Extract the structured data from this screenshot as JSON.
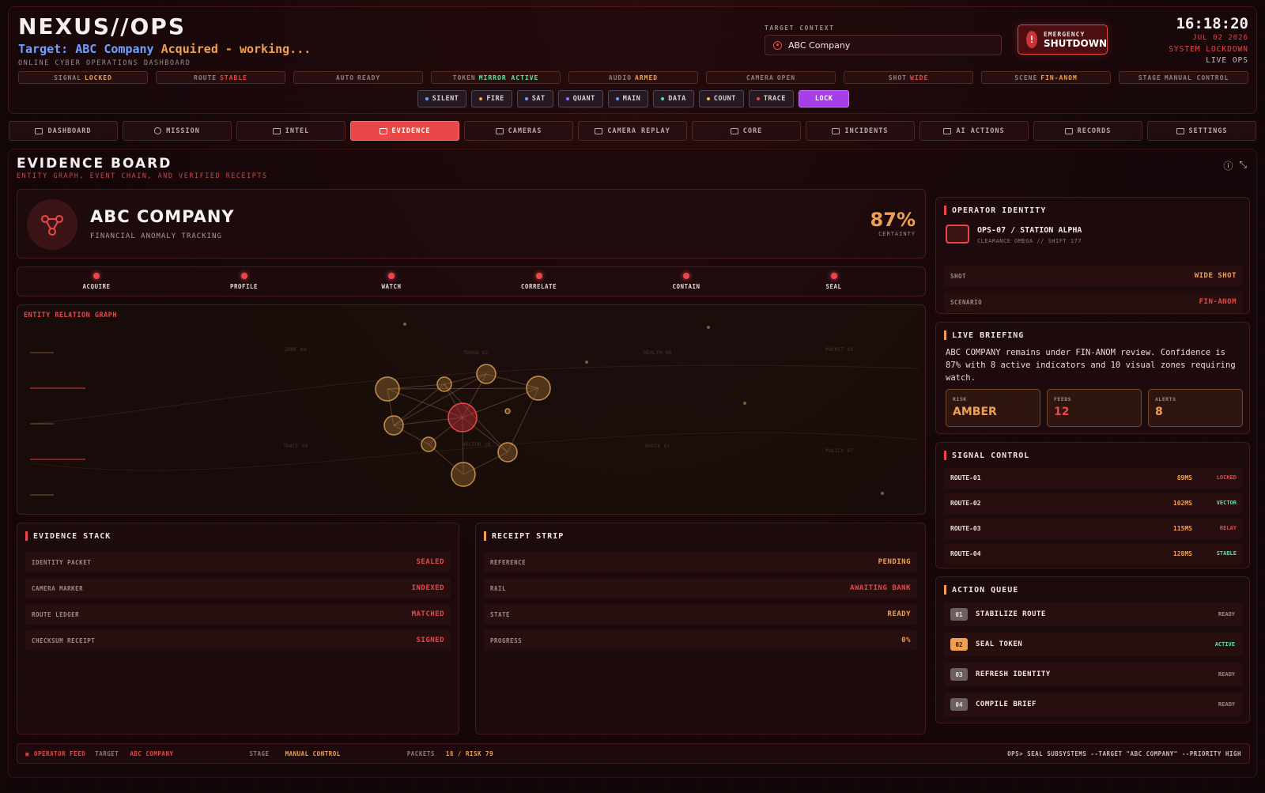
{
  "header": {
    "brand": "NEXUS//OPS",
    "target_prefix": "Target:",
    "target_name": "ABC Company",
    "target_status": "Acquired - working...",
    "subtitle": "ONLINE CYBER OPERATIONS DASHBOARD",
    "context_label": "TARGET CONTEXT",
    "context_value": "ABC Company",
    "emergency_l1": "EMERGENCY",
    "emergency_l2": "SHUTDOWN",
    "time": "16:18:20",
    "date": "JUL 02 2026",
    "lockdown": "SYSTEM LOCKDOWN",
    "live": "LIVE OPS"
  },
  "status_chips": [
    {
      "k": "SIGNAL",
      "v": "LOCKED",
      "color": "#f0a050"
    },
    {
      "k": "ROUTE",
      "v": "STABLE",
      "color": "#e84848"
    },
    {
      "k": "AUTO",
      "v": "READY",
      "color": "#8c807c"
    },
    {
      "k": "TOKEN",
      "v": "MIRROR ACTIVE",
      "color": "#5ee0a0"
    },
    {
      "k": "AUDIO",
      "v": "ARMED",
      "color": "#f0a050"
    },
    {
      "k": "CAMERA",
      "v": "OPEN",
      "color": "#8c807c"
    },
    {
      "k": "SHOT",
      "v": "WIDE",
      "color": "#e84848"
    },
    {
      "k": "SCENE",
      "v": "FIN-ANOM",
      "color": "#f0a050"
    },
    {
      "k": "STAGE",
      "v": "MANUAL CONTROL",
      "color": "#8c807c"
    }
  ],
  "modes": [
    {
      "label": "SILENT",
      "dot": "#6fa0ff"
    },
    {
      "label": "FIRE",
      "dot": "#f0a050"
    },
    {
      "label": "SAT",
      "dot": "#6fa0ff"
    },
    {
      "label": "QUANT",
      "dot": "#a070ff"
    },
    {
      "label": "MAIN",
      "dot": "#6fa0ff"
    },
    {
      "label": "DATA",
      "dot": "#5ee0a0"
    },
    {
      "label": "COUNT",
      "dot": "#f0c050"
    },
    {
      "label": "TRACE",
      "dot": "#e84848"
    },
    {
      "label": "LOCK",
      "dot": ""
    }
  ],
  "nav": [
    "DASHBOARD",
    "MISSION",
    "INTEL",
    "EVIDENCE",
    "CAMERAS",
    "CAMERA REPLAY",
    "CORE",
    "INCIDENTS",
    "AI ACTIONS",
    "RECORDS",
    "SETTINGS"
  ],
  "board": {
    "title": "EVIDENCE BOARD",
    "subtitle": "ENTITY GRAPH, EVENT CHAIN, AND VERIFIED RECEIPTS"
  },
  "company": {
    "name": "ABC COMPANY",
    "sub": "FINANCIAL ANOMALY TRACKING",
    "certainty": "87%",
    "certainty_label": "CERTAINTY"
  },
  "steps": [
    "ACQUIRE",
    "PROFILE",
    "WATCH",
    "CORRELATE",
    "CONTAIN",
    "SEAL"
  ],
  "graph": {
    "title": "ENTITY RELATION GRAPH",
    "labels": [
      "ZONE 04",
      "TOKEN 92",
      "REALTH 96",
      "PACKET 81",
      "TRACE 50",
      "VECTOR 18",
      "ROUTE 61",
      "POLICY 87"
    ]
  },
  "evidence_stack": {
    "title": "EVIDENCE STACK",
    "rows": [
      {
        "k": "IDENTITY PACKET",
        "v": "SEALED"
      },
      {
        "k": "CAMERA MARKER",
        "v": "INDEXED"
      },
      {
        "k": "ROUTE LEDGER",
        "v": "MATCHED"
      },
      {
        "k": "CHECKSUM RECEIPT",
        "v": "SIGNED"
      }
    ]
  },
  "receipt_strip": {
    "title": "RECEIPT STRIP",
    "rows": [
      {
        "k": "REFERENCE",
        "v": "PENDING",
        "c": "amber"
      },
      {
        "k": "RAIL",
        "v": "AWAITING BANK",
        "c": "red"
      },
      {
        "k": "STATE",
        "v": "READY",
        "c": "amber"
      },
      {
        "k": "PROGRESS",
        "v": "0%",
        "c": "amber"
      }
    ]
  },
  "operator": {
    "title": "OPERATOR IDENTITY",
    "name": "OPS-07 / STATION ALPHA",
    "clearance": "CLEARANCE OMEGA // SHIFT 177",
    "rows": [
      {
        "k": "SHOT",
        "v": "WIDE SHOT",
        "c": "amber"
      },
      {
        "k": "SCENARIO",
        "v": "FIN-ANOM",
        "c": "red"
      }
    ]
  },
  "briefing": {
    "title": "LIVE BRIEFING",
    "text": "ABC COMPANY remains under FIN-ANOM review. Confidence is 87% with 8 active indicators and 10 visual zones requiring watch.",
    "tiles": [
      {
        "k": "RISK",
        "v": "AMBER",
        "c": "#f0a050"
      },
      {
        "k": "FEEDS",
        "v": "12",
        "c": "#e84848"
      },
      {
        "k": "ALERTS",
        "v": "8",
        "c": "#f0a050"
      }
    ]
  },
  "signal": {
    "title": "SIGNAL CONTROL",
    "routes": [
      {
        "n": "ROUTE-01",
        "ms": "89MS",
        "s": "LOCKED",
        "c": "red"
      },
      {
        "n": "ROUTE-02",
        "ms": "102MS",
        "s": "VECTOR",
        "c": "green"
      },
      {
        "n": "ROUTE-03",
        "ms": "115MS",
        "s": "RELAY",
        "c": "red"
      },
      {
        "n": "ROUTE-04",
        "ms": "128MS",
        "s": "STABLE",
        "c": "green"
      }
    ]
  },
  "queue": {
    "title": "ACTION QUEUE",
    "items": [
      {
        "num": "01",
        "label": "STABILIZE ROUTE",
        "st": "READY",
        "active": false
      },
      {
        "num": "02",
        "label": "SEAL TOKEN",
        "st": "ACTIVE",
        "active": true
      },
      {
        "num": "03",
        "label": "REFRESH IDENTITY",
        "st": "READY",
        "active": false
      },
      {
        "num": "04",
        "label": "COMPILE BRIEF",
        "st": "READY",
        "active": false
      }
    ]
  },
  "feed": {
    "label": "OPERATOR FEED",
    "target_k": "TARGET",
    "target_v": "ABC COMPANY",
    "stage_k": "STAGE",
    "stage_v": "MANUAL CONTROL",
    "packets_k": "PACKETS",
    "packets_v": "18 / RISK 79",
    "command": "OPS> SEAL SUBSYSTEMS --TARGET \"ABC COMPANY\" --PRIORITY HIGH"
  }
}
